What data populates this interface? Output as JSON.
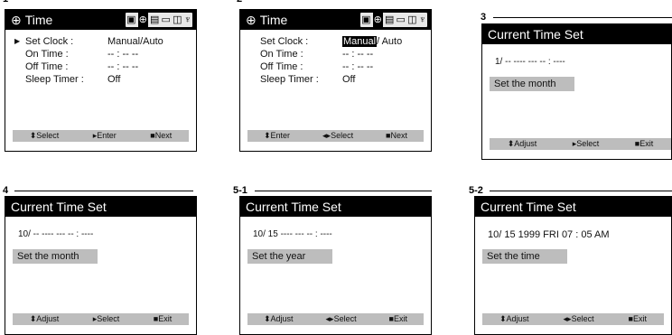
{
  "steps": [
    "1",
    "2",
    "3",
    "4",
    "5-1",
    "5-2"
  ],
  "time_menu": {
    "title": "Time",
    "icons": [
      "tv-icon",
      "clock-icon",
      "calendar-icon",
      "tape-icon",
      "tuner-icon",
      "antenna-icon"
    ],
    "items": [
      {
        "label": "Set Clock :",
        "value": "Manual/Auto"
      },
      {
        "label": "On Time :",
        "value": "-- : -- --"
      },
      {
        "label": "Off Time :",
        "value": "-- : -- --"
      },
      {
        "label": "Sleep Timer :",
        "value": "Off"
      }
    ],
    "panel2_manual": "Manual",
    "panel2_auto": "/ Auto",
    "footer1": [
      "Select",
      "Enter",
      "Next"
    ],
    "footer2": [
      "Enter",
      "Select",
      "Next"
    ]
  },
  "time_set": {
    "title": "Current Time Set",
    "panel3_line": "1/ --  ----  ---  -- : ----",
    "panel4_line": "10/ --  ----  ---  -- : ----",
    "panel51_line": "10/ 15  ----  ---  -- : ----",
    "panel52_line": "10/ 15  1999  FRI  07 : 05 AM",
    "set_month": "Set the month",
    "set_year": "Set the year",
    "set_time": "Set the time",
    "footer": [
      "Adjust",
      "Select",
      "Exit"
    ]
  }
}
